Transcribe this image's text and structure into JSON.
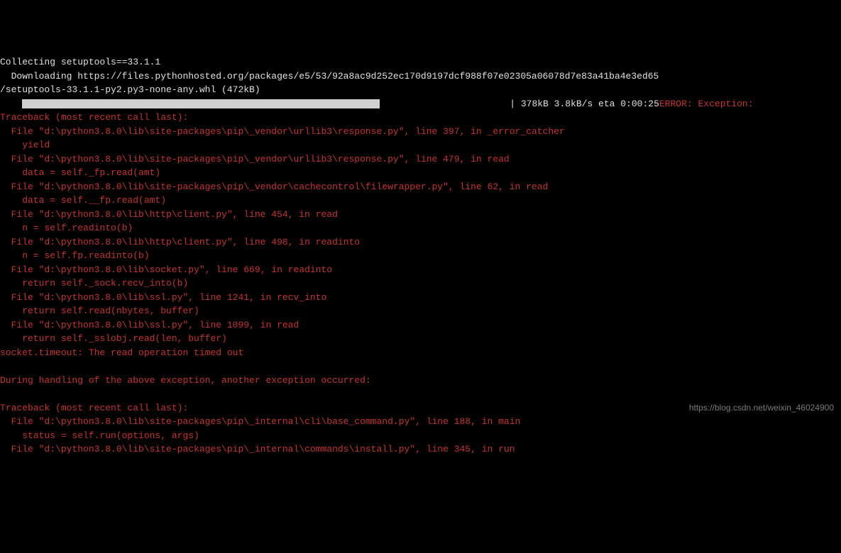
{
  "lines": {
    "collecting": "Collecting setuptools==33.1.1",
    "downloading": "  Downloading https://files.pythonhosted.org/packages/e5/53/92a8ac9d252ec170d9197dcf988f07e02305a06078d7e83a41ba4e3ed65",
    "whl": "/setuptools-33.1.1-py2.py3-none-any.whl (472kB)",
    "progress_prefix": "    ",
    "progress_stats": "| 378kB 3.8kB/s eta 0:00:25",
    "error_label": "ERROR: Exception:",
    "tb1": "Traceback (most recent call last):",
    "f1": "  File \"d:\\python3.8.0\\lib\\site-packages\\pip\\_vendor\\urllib3\\response.py\", line 397, in _error_catcher",
    "y1": "    yield",
    "f2": "  File \"d:\\python3.8.0\\lib\\site-packages\\pip\\_vendor\\urllib3\\response.py\", line 479, in read",
    "d2": "    data = self._fp.read(amt)",
    "f3": "  File \"d:\\python3.8.0\\lib\\site-packages\\pip\\_vendor\\cachecontrol\\filewrapper.py\", line 62, in read",
    "d3": "    data = self.__fp.read(amt)",
    "f4": "  File \"d:\\python3.8.0\\lib\\http\\client.py\", line 454, in read",
    "n4": "    n = self.readinto(b)",
    "f5": "  File \"d:\\python3.8.0\\lib\\http\\client.py\", line 498, in readinto",
    "n5": "    n = self.fp.readinto(b)",
    "f6": "  File \"d:\\python3.8.0\\lib\\socket.py\", line 669, in readinto",
    "r6": "    return self._sock.recv_into(b)",
    "f7": "  File \"d:\\python3.8.0\\lib\\ssl.py\", line 1241, in recv_into",
    "r7": "    return self.read(nbytes, buffer)",
    "f8": "  File \"d:\\python3.8.0\\lib\\ssl.py\", line 1099, in read",
    "r8": "    return self._sslobj.read(len, buffer)",
    "timeout": "socket.timeout: The read operation timed out",
    "blank": "",
    "during": "During handling of the above exception, another exception occurred:",
    "tb2": "Traceback (most recent call last):",
    "f9": "  File \"d:\\python3.8.0\\lib\\site-packages\\pip\\_internal\\cli\\base_command.py\", line 188, in main",
    "s9": "    status = self.run(options, args)",
    "f10": "  File \"d:\\python3.8.0\\lib\\site-packages\\pip\\_internal\\commands\\install.py\", line 345, in run"
  },
  "progress": {
    "filled": 56,
    "total": 72
  },
  "watermark": "https://blog.csdn.net/weixin_46024900"
}
